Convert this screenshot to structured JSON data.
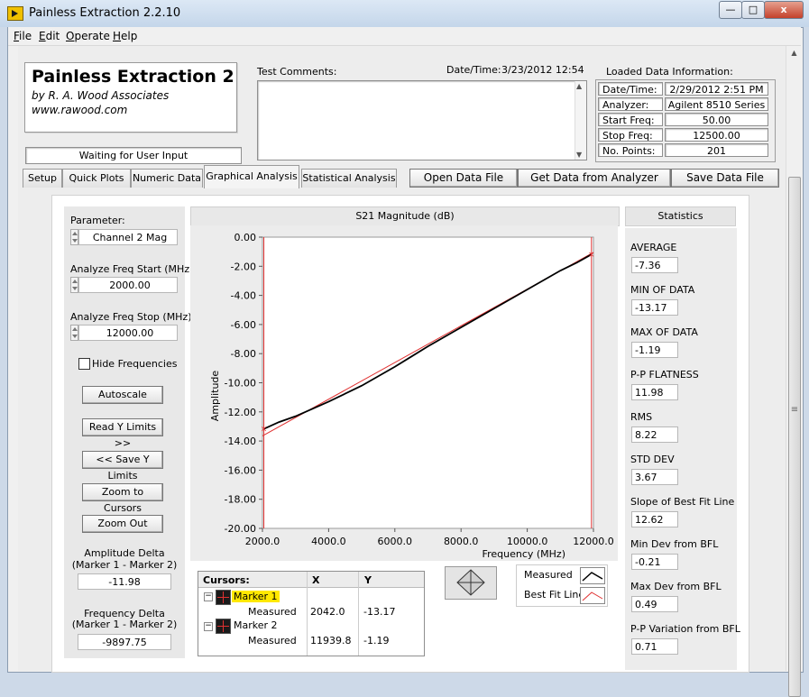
{
  "window": {
    "title": "Painless Extraction 2.2.10",
    "min": "—",
    "max": "□",
    "close": "x"
  },
  "menu": [
    "File",
    "Edit",
    "Operate",
    "Help"
  ],
  "header": {
    "app_title": "Painless Extraction 2",
    "byline": "by R. A. Wood Associates",
    "website": "www.rawood.com",
    "status": "Waiting for User Input"
  },
  "comments": {
    "label": "Test Comments:",
    "datetime_label": "Date/Time:",
    "datetime_value": "3/23/2012  12:54",
    "text": ""
  },
  "loaded": {
    "title": "Loaded Data Information:",
    "rows": [
      {
        "label": "Date/Time:",
        "value": "2/29/2012 2:51 PM"
      },
      {
        "label": "Analyzer:",
        "value": "Agilent 8510 Series"
      },
      {
        "label": "Start Freq:",
        "value": "50.00"
      },
      {
        "label": "Stop Freq:",
        "value": "12500.00"
      },
      {
        "label": "No. Points:",
        "value": "201"
      }
    ]
  },
  "tabs": [
    "Setup",
    "Quick Plots",
    "Numeric Data",
    "Graphical Analysis",
    "Statistical Analysis"
  ],
  "active_tab": "Graphical Analysis",
  "actions": {
    "open": "Open Data File",
    "get": "Get Data from Analyzer",
    "save": "Save Data File"
  },
  "controls": {
    "parameter_label": "Parameter:",
    "parameter_value": "Channel 2 Mag",
    "start_label": "Analyze Freq Start (MHz)",
    "start_value": "2000.00",
    "stop_label": "Analyze Freq Stop (MHz)",
    "stop_value": "12000.00",
    "hide_freq": "Hide Frequencies",
    "autoscale": "Autoscale",
    "read_y": "Read Y Limits >>",
    "save_y": "<< Save Y Limits",
    "zoom_cursors": "Zoom to Cursors",
    "zoom_out": "Zoom Out",
    "amp_delta_label1": "Amplitude Delta",
    "amp_delta_label2": "(Marker 1 - Marker 2)",
    "amp_delta_value": "-11.98",
    "freq_delta_label1": "Frequency Delta",
    "freq_delta_label2": "(Marker 1 - Marker 2)",
    "freq_delta_value": "-9897.75"
  },
  "cursors": {
    "headers": [
      "Cursors:",
      "X",
      "Y"
    ],
    "rows": [
      {
        "name": "Marker 1",
        "sub": "Measured",
        "x": "2042.0",
        "y": "-13.17"
      },
      {
        "name": "Marker 2",
        "sub": "Measured",
        "x": "11939.8",
        "y": "-1.19"
      }
    ],
    "collapse": "−"
  },
  "legend": {
    "measured": "Measured",
    "best_fit": "Best Fit Line",
    "measured_color": "#000000",
    "best_fit_color": "#e03030"
  },
  "statistics": {
    "title": "Statistics",
    "items": [
      {
        "label": "AVERAGE",
        "value": "-7.36"
      },
      {
        "label": "MIN OF DATA",
        "value": "-13.17"
      },
      {
        "label": "MAX OF DATA",
        "value": "-1.19"
      },
      {
        "label": "P-P FLATNESS",
        "value": "11.98"
      },
      {
        "label": "RMS",
        "value": "8.22"
      },
      {
        "label": "STD DEV",
        "value": "3.67"
      },
      {
        "label": "Slope of Best Fit Line",
        "value": "12.62"
      },
      {
        "label": "Min Dev from BFL",
        "value": "-0.21"
      },
      {
        "label": "Max Dev from BFL",
        "value": "0.49"
      },
      {
        "label": "P-P Variation from BFL",
        "value": "0.71"
      }
    ]
  },
  "scrollbar": {
    "grip": "≡",
    "up": "▲",
    "down": "▼"
  },
  "chart_data": {
    "type": "line",
    "title": "S21 Magnitude (dB)",
    "xlabel": "Frequency (MHz)",
    "ylabel": "Amplitude",
    "xlim": [
      2000,
      12000
    ],
    "ylim": [
      -20,
      0
    ],
    "x_ticks": [
      "2000.0",
      "4000.0",
      "6000.0",
      "8000.0",
      "10000.0",
      "12000.0"
    ],
    "y_ticks": [
      "0.00",
      "-2.00",
      "-4.00",
      "-6.00",
      "-8.00",
      "-10.00",
      "-12.00",
      "-14.00",
      "-16.00",
      "-18.00",
      "-20.00"
    ],
    "grid": false,
    "series": [
      {
        "name": "Measured",
        "color": "#000000",
        "x": [
          2042,
          2500,
          3000,
          3500,
          4000,
          4500,
          5000,
          5500,
          6000,
          6500,
          7000,
          7500,
          8000,
          8500,
          9000,
          9500,
          10000,
          10500,
          11000,
          11500,
          11940
        ],
        "y": [
          -13.17,
          -12.7,
          -12.3,
          -11.8,
          -11.3,
          -10.75,
          -10.2,
          -9.55,
          -8.9,
          -8.2,
          -7.5,
          -6.85,
          -6.2,
          -5.55,
          -4.9,
          -4.25,
          -3.6,
          -2.95,
          -2.3,
          -1.75,
          -1.19
        ]
      },
      {
        "name": "Best Fit Line",
        "color": "#e03030",
        "x": [
          2000,
          12000
        ],
        "y": [
          -13.65,
          -1.05
        ]
      }
    ],
    "cursors": [
      {
        "x": 2042,
        "y": -13.17
      },
      {
        "x": 11940,
        "y": -1.19
      }
    ]
  }
}
